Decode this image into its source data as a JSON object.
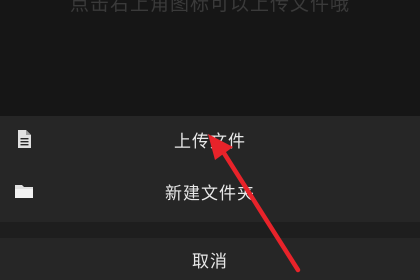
{
  "background_hint": {
    "text": "点击右上角图标可以上传文件哦"
  },
  "action_sheet": {
    "items": [
      {
        "label": "上传文件",
        "icon": "document-icon"
      },
      {
        "label": "新建文件夹",
        "icon": "folder-icon"
      }
    ],
    "cancel_label": "取消"
  },
  "annotation": {
    "arrow_color": "#e8232a",
    "points_to": "上传文件"
  },
  "colors": {
    "sheet_background": "#262626",
    "text": "#e8e8e8"
  }
}
